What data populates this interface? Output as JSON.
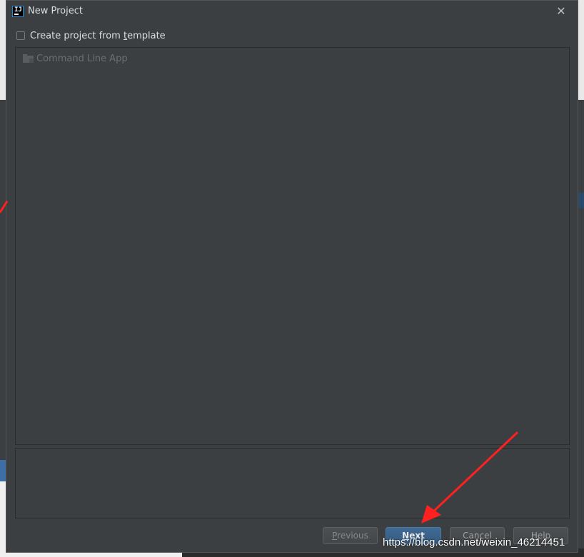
{
  "window": {
    "title": "New Project",
    "icon": "intellij-icon",
    "icon_letters": "IJ",
    "close_glyph": "✕"
  },
  "template_checkbox": {
    "label_before": "Create project from ",
    "label_mnemonic": "t",
    "label_after": "emplate",
    "checked": false
  },
  "template_list": {
    "items": [
      {
        "label": "Command Line App",
        "icon": "folder-icon",
        "enabled": false
      }
    ]
  },
  "buttons": {
    "previous": {
      "mnemonic": "P",
      "rest": "revious",
      "enabled": false
    },
    "next": {
      "mnemonic": "N",
      "rest": "ext",
      "default": true
    },
    "cancel": {
      "label": "Cancel"
    },
    "help": {
      "mnemonic": "H",
      "rest": "elp"
    }
  },
  "watermark": "https://blog.csdn.net/weixin_46214451",
  "colors": {
    "dialog_bg": "#3c3f41",
    "primary_button": "#375b80",
    "annotation_arrow": "#ff2020"
  }
}
